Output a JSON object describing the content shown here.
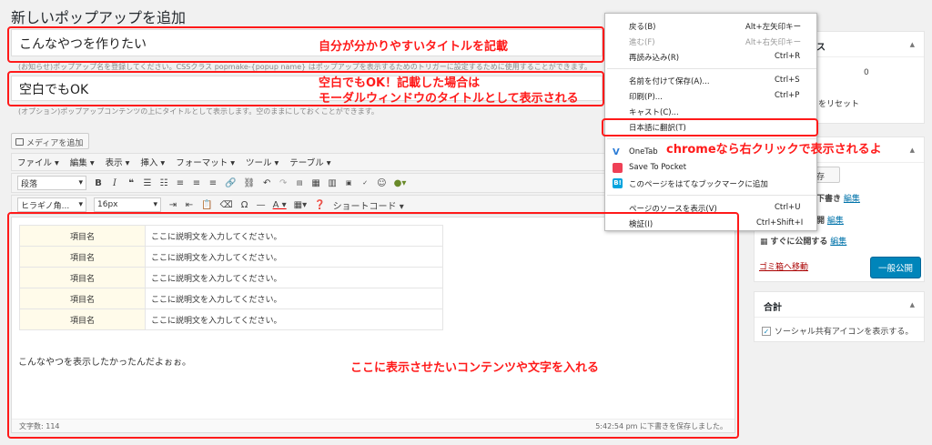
{
  "page": {
    "title": "新しいポップアップを追加"
  },
  "title_field": {
    "value": "こんなやつを作りたい",
    "help": "(お知らせ)ポップアップ名を登録してください。CSSクラス popmake-{popup name} はポップアップを表示するためのトリガーに設定するために使用することができます。"
  },
  "subtitle_field": {
    "value": "空白でもOK",
    "help": "(オプション)ポップアップコンテンツの上にタイトルとして表示します。空のままにしておくことができます。"
  },
  "media_button": {
    "label": "メディアを追加"
  },
  "menubar": {
    "items": [
      "ファイル ▾",
      "編集 ▾",
      "表示 ▾",
      "挿入 ▾",
      "フォーマット ▾",
      "ツール ▾",
      "テーブル ▾"
    ]
  },
  "toolbar": {
    "format_select": "段落",
    "font_select": "ヒラギノ角...",
    "size_select": "16px",
    "shortcode": "ショートコード"
  },
  "editor": {
    "rows": [
      {
        "label": "項目名",
        "value": "ここに説明文を入力してください。"
      },
      {
        "label": "項目名",
        "value": "ここに説明文を入力してください。"
      },
      {
        "label": "項目名",
        "value": "ここに説明文を入力してください。"
      },
      {
        "label": "項目名",
        "value": "ここに説明文を入力してください。"
      },
      {
        "label": "項目名",
        "value": "ここに説明文を入力してください。"
      }
    ],
    "content": "こんなやつを表示したかったんだよぉぉ。",
    "word_count": "文字数: 114",
    "saved": "5:42:54 pm に下書きを保存しました。"
  },
  "annotations": {
    "title": "自分が分かりやすいタイトルを記載",
    "subtitle_line1": "空白でもOK！記載した場合は",
    "subtitle_line2": "モーダルウィンドウのタイトルとして表示される",
    "chrome": "chromeなら右クリックで表示されるよ",
    "content": "ここに表示させたいコンテンツや文字を入れる"
  },
  "context_menu": {
    "back": {
      "label": "戻る(B)",
      "shortcut": "Alt+左矢印キー"
    },
    "forward": {
      "label": "進む(F)",
      "shortcut": "Alt+右矢印キー"
    },
    "reload": {
      "label": "再読み込み(R)",
      "shortcut": "Ctrl+R"
    },
    "save_as": {
      "label": "名前を付けて保存(A)...",
      "shortcut": "Ctrl+S"
    },
    "print": {
      "label": "印刷(P)...",
      "shortcut": "Ctrl+P"
    },
    "cast": {
      "label": "キャスト(C)..."
    },
    "translate": {
      "label": "日本語に翻訳(T)"
    },
    "onetab": {
      "label": "OneTab"
    },
    "pocket": {
      "label": "Save To Pocket"
    },
    "hatena": {
      "label": "このページをはてなブックマークに追加"
    },
    "view_source": {
      "label": "ページのソースを表示(V)",
      "shortcut": "Ctrl+U"
    },
    "inspect": {
      "label": "検証(I)",
      "shortcut": "Ctrl+Shift+I"
    }
  },
  "sidebar": {
    "box1_head_suffix": "ス",
    "count": "0",
    "reset": "をリセット",
    "save_draft": "保存",
    "status_label": "下書き",
    "edit": "編集",
    "visibility_label": "開",
    "publish_label": "すぐに公開する",
    "trash": "ゴミ箱へ移動",
    "publish_button": "一般公開",
    "box3_title": "合計",
    "checkbox_label": "ソーシャル共有アイコンを表示する。"
  },
  "colors": {
    "annotation": "#ff1a1a",
    "link": "#0073aa",
    "primary": "#0085ba"
  }
}
